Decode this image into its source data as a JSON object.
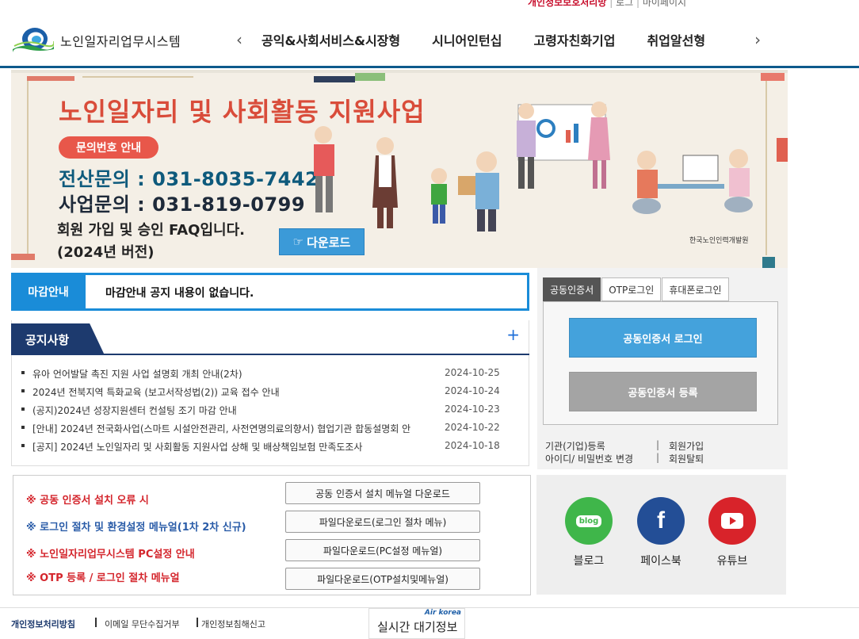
{
  "util": {
    "privacy": "개인정보보호처리방",
    "login": "로그",
    "mypage": "마이페이지"
  },
  "header": {
    "logo_title": "노인일자리업무시스템",
    "nav": [
      "공익&사회서비스&시장형",
      "시니어인턴십",
      "고령자친화기업",
      "취업알선형"
    ]
  },
  "banner": {
    "title": "노인일자리 및 사회활동 지원사업",
    "pill": "문의번호 안내",
    "phone1": "전산문의 : 031-8035-7442",
    "phone2": "사업문의 : 031-819-0799",
    "faq": "회원 가입 및 승인 FAQ입니다.",
    "version": "(2024년 버전)",
    "download": "다운로드",
    "seal": "한국노인인력개발원"
  },
  "deadline": {
    "label": "마감안내",
    "message": "마감안내 공지 내용이 없습니다."
  },
  "notice": {
    "title": "공지사항",
    "more": "+",
    "items": [
      {
        "title": "유아 언어발달 촉진 지원 사업 설명회 개최 안내(2차)",
        "date": "2024-10-25"
      },
      {
        "title": "2024년 전북지역 특화교육 (보고서작성법(2)) 교육 접수 안내",
        "date": "2024-10-24"
      },
      {
        "title": "(공지)2024년 성장지원센터 컨설팅 조기 마감 안내",
        "date": "2024-10-23"
      },
      {
        "title": "[안내] 2024년 전국화사업(스마트 시설안전관리, 사전연명의료의향서) 협업기관 합동설명회 안",
        "date": "2024-10-22"
      },
      {
        "title": "[공지] 2024년 노인일자리 및 사회활동 지원사업 상해 및 배상책임보험 만족도조사",
        "date": "2024-10-18"
      }
    ]
  },
  "login": {
    "tabs": [
      "공동인증서",
      "OTP로그인",
      "휴대폰로그인"
    ],
    "cert_login": "공동인증서 로그인",
    "cert_register": "공동인증서 등록",
    "links": {
      "org_register": "기관(기업)등록",
      "member_join": "회원가입",
      "id_pw_change": "아이디/ 비밀번호 변경",
      "member_leave": "회원탈퇴"
    }
  },
  "guides": [
    {
      "text": "※ 공동 인증서 설치 오류 시",
      "button": "공동 인증서 설치 메뉴얼 다운로드"
    },
    {
      "text": "※ 로그인 절차 및 환경설정 메뉴얼(1차 2차 신규)",
      "button": "파일다운로드(로그인 절차 메뉴)"
    },
    {
      "text": "※ 노인일자리업무시스템 PC설정 안내",
      "button": "파일다운로드(PC설정 메뉴얼)"
    },
    {
      "text": "※ OTP 등록 / 로그인 절차 메뉴얼",
      "button": "파일다운로드(OTP설치및메뉴얼)"
    }
  ],
  "social": {
    "blog": {
      "label": "블로그",
      "icon_text": "blog"
    },
    "facebook": {
      "label": "페이스북"
    },
    "youtube": {
      "label": "유튜브"
    }
  },
  "footer": {
    "privacy": "개인정보처리방침",
    "email": "이메일 무단수집거부",
    "report": "개인정보침해신고",
    "air_brand": "Air korea",
    "air_title": "실시간 대기정보"
  },
  "colors": {
    "primary_blue": "#1a8cd8",
    "navy": "#1d3a6e",
    "red": "#d4252c",
    "banner_red": "#d94c3a"
  }
}
